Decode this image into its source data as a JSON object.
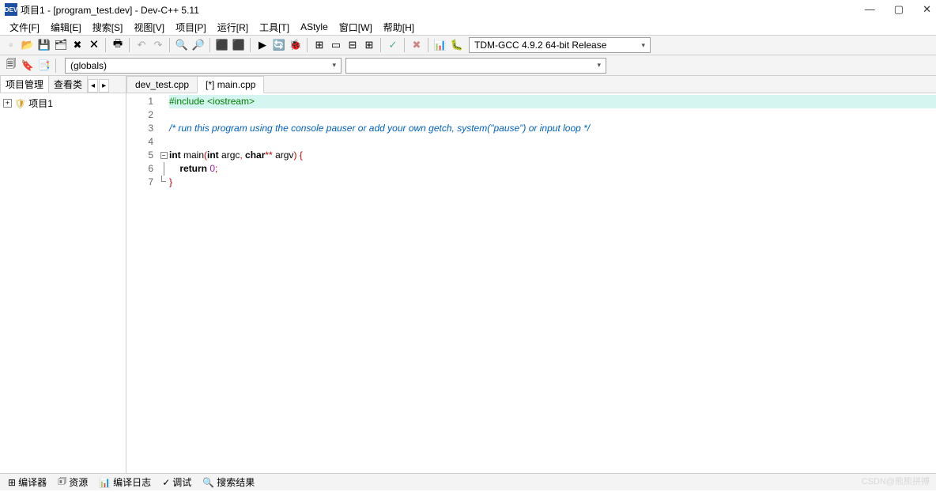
{
  "title": "项目1 - [program_test.dev] - Dev-C++ 5.11",
  "window_controls": {
    "min": "—",
    "max": "▢",
    "close": "✕"
  },
  "menu": [
    "文件[F]",
    "编辑[E]",
    "搜索[S]",
    "视图[V]",
    "项目[P]",
    "运行[R]",
    "工具[T]",
    "AStyle",
    "窗口[W]",
    "帮助[H]"
  ],
  "compiler_combo": "TDM-GCC 4.9.2 64-bit Release",
  "globals_combo": "(globals)",
  "side_tabs": {
    "a": "项目管理",
    "b": "查看类",
    "left": "◂",
    "right": "▸"
  },
  "tree": {
    "expand": "+",
    "root": "项目1"
  },
  "file_tabs": [
    {
      "label": "dev_test.cpp",
      "active": false
    },
    {
      "label": "[*] main.cpp",
      "active": true
    }
  ],
  "gutter": [
    "1",
    "2",
    "3",
    "4",
    "5",
    "6",
    "7"
  ],
  "code": {
    "l1_pre": "#include <iostream>",
    "l2": "",
    "l3_com": "/* run this program using the console pauser or add your own getch, system(\"pause\") or input loop */",
    "l4": "",
    "l5_kw1": "int",
    "l5_id1": " main",
    "l5_p1": "(",
    "l5_kw2": "int",
    "l5_id2": " argc",
    "l5_p2": ", ",
    "l5_kw3": "char",
    "l5_p3": "**",
    "l5_id3": " argv",
    "l5_p4": ")",
    "l5_p5": " {",
    "l6_indent": "    ",
    "l6_kw": "return",
    "l6_sp": " ",
    "l6_num": "0",
    "l6_p": ";",
    "l7_p": "}"
  },
  "status_tabs": [
    {
      "icon": "⊞",
      "label": "编译器"
    },
    {
      "icon": "🗊",
      "label": "资源"
    },
    {
      "icon": "📊",
      "label": "编译日志"
    },
    {
      "icon": "✓",
      "label": "调试"
    },
    {
      "icon": "🔍",
      "label": "搜索结果"
    }
  ],
  "watermark": "CSDN@熊熊拼搏"
}
